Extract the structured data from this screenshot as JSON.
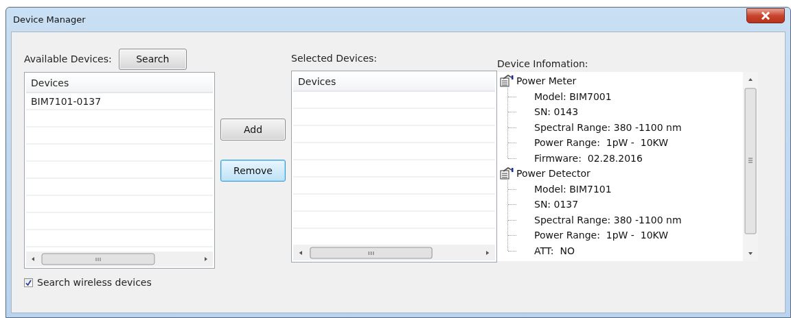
{
  "window": {
    "title": "Device Manager"
  },
  "available": {
    "label": "Available Devices:",
    "search_button": "Search",
    "column": "Devices",
    "rows": [
      "BIM7101-0137"
    ]
  },
  "actions": [
    {
      "label": "Add",
      "focused": false
    },
    {
      "label": "Remove",
      "focused": true
    }
  ],
  "search_wireless": {
    "label": "Search wireless devices",
    "checked": true
  },
  "selected": {
    "label": "Selected Devices:",
    "column": "Devices"
  },
  "info": {
    "label": "Device Infomation:",
    "tree": [
      {
        "label": "Power Meter",
        "children": [
          {
            "label": "Model: BIM7001"
          },
          {
            "label": "SN: 0143"
          },
          {
            "label": "Spectral Range: 380 -1100 nm"
          },
          {
            "label": "Power Range:  1pW -  10KW"
          },
          {
            "label": "Firmware:  02.28.2016"
          }
        ]
      },
      {
        "label": "Power Detector",
        "children": [
          {
            "label": "Model: BIM7101"
          },
          {
            "label": "SN: 0137"
          },
          {
            "label": "Spectral Range: 380 -1100 nm"
          },
          {
            "label": "Power Range:  1pW -  10KW"
          },
          {
            "label": "ATT:  NO"
          }
        ]
      }
    ]
  }
}
